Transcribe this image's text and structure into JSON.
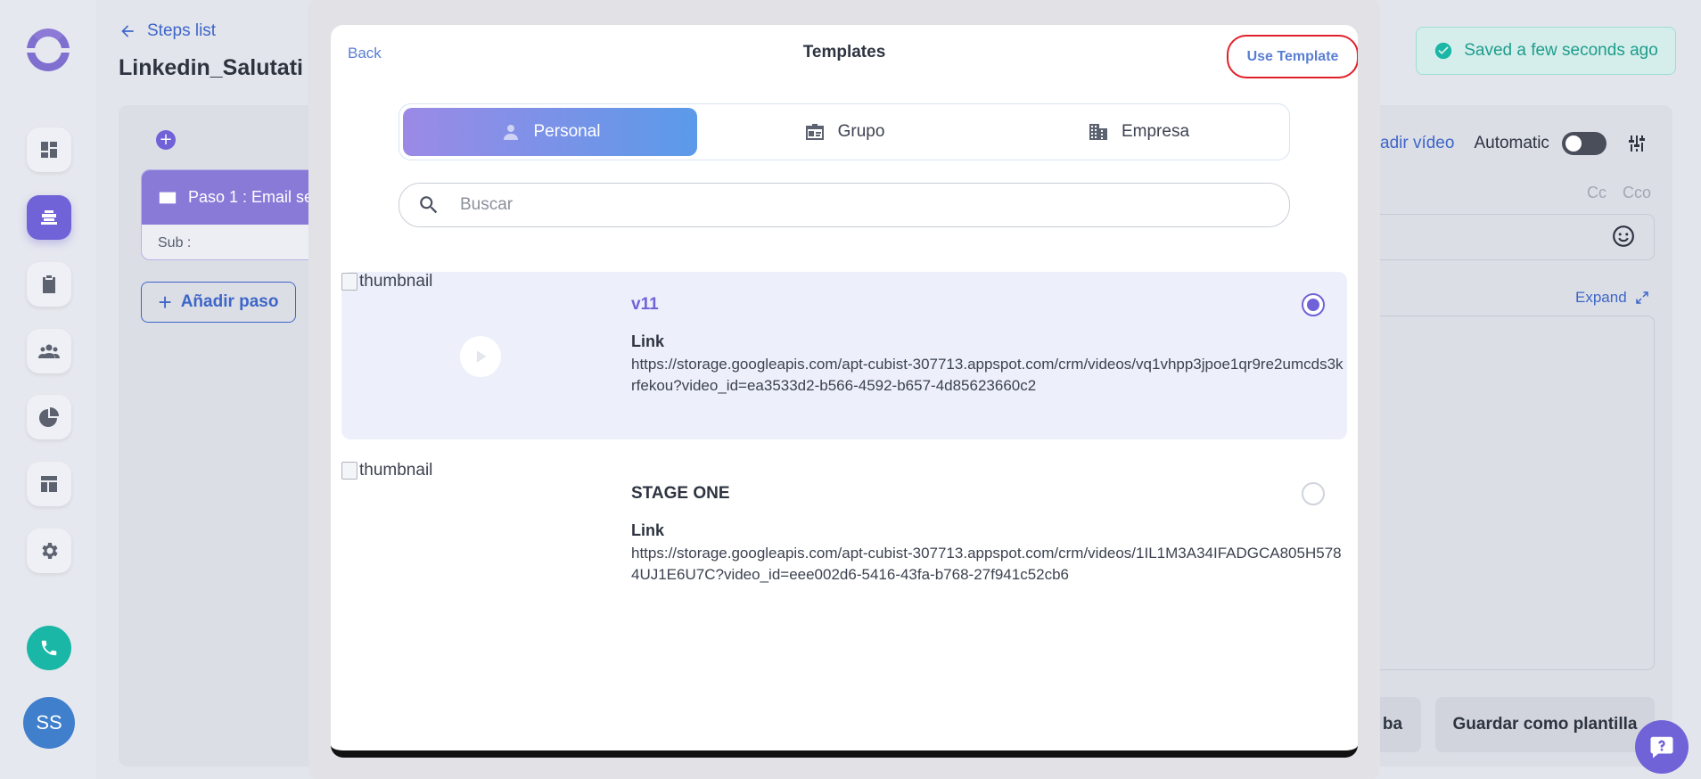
{
  "page": {
    "back_link": "Steps list",
    "title": "Linkedin_Salutati",
    "saved_status": "Saved a few seconds ago"
  },
  "step": {
    "header": "Paso 1 : Email se",
    "subject": "Sub :",
    "add_step": "Añadir paso"
  },
  "editor": {
    "add_video": "adir vídeo",
    "automatic": "Automatic",
    "cc": "Cc",
    "cco": "Cco",
    "expand": "Expand",
    "test_button": "ba",
    "save_template_button": "Guardar como plantilla"
  },
  "sidebar": {
    "avatar_initials": "SS",
    "items": [
      {
        "icon": "dashboard-icon"
      },
      {
        "icon": "layers-icon"
      },
      {
        "icon": "clipboard-icon"
      },
      {
        "icon": "people-icon"
      },
      {
        "icon": "pie-chart-icon"
      },
      {
        "icon": "layout-icon"
      },
      {
        "icon": "gear-icon"
      }
    ]
  },
  "modal": {
    "back": "Back",
    "title": "Templates",
    "use_template": "Use Template",
    "tabs": [
      {
        "label": "Personal",
        "icon": "person-icon",
        "active": true
      },
      {
        "label": "Grupo",
        "icon": "badge-icon",
        "active": false
      },
      {
        "label": "Empresa",
        "icon": "building-icon",
        "active": false
      }
    ],
    "search_placeholder": "Buscar",
    "templates": [
      {
        "thumbnail_alt": "thumbnail",
        "name": "v11",
        "link_label": "Link",
        "link": "https://storage.googleapis.com/apt-cubist-307713.appspot.com/crm/videos/vq1vhpp3jpoe1qr9re2umcds3krfekou?video_id=ea3533d2-b566-4592-b657-4d85623660c2",
        "selected": true
      },
      {
        "thumbnail_alt": "thumbnail",
        "name": "STAGE ONE",
        "link_label": "Link",
        "link": "https://storage.googleapis.com/apt-cubist-307713.appspot.com/crm/videos/1IL1M3A34IFADGCA805H5784UJ1E6U7C?video_id=eee002d6-5416-43fa-b768-27f941c52cb6",
        "selected": false
      }
    ]
  },
  "colors": {
    "accent": "#6f63d7",
    "link": "#3d66c8",
    "success": "#1ab7a6",
    "highlight_border": "#e0212b"
  }
}
